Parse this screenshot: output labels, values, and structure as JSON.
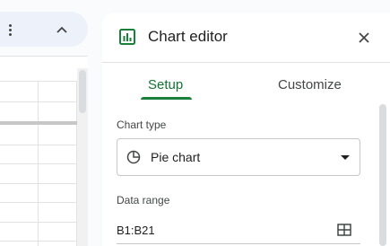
{
  "colors": {
    "accent": "#188038",
    "tab_active_text": "#137333",
    "panel_bg": "#ffffff",
    "page_bg": "#f9fbfd"
  },
  "toolbar": {
    "more_icon": "more-vert-icon",
    "collapse_icon": "chevron-up-icon"
  },
  "editor": {
    "icon": "insert-chart-icon",
    "title": "Chart editor",
    "close_icon": "close-icon",
    "tabs": [
      {
        "label": "Setup",
        "active": true
      },
      {
        "label": "Customize",
        "active": false
      }
    ],
    "chart_type": {
      "label": "Chart type",
      "value": "Pie chart",
      "icon": "pie-chart-icon"
    },
    "data_range": {
      "label": "Data range",
      "value": "B1:B21",
      "icon": "grid-select-icon"
    }
  }
}
